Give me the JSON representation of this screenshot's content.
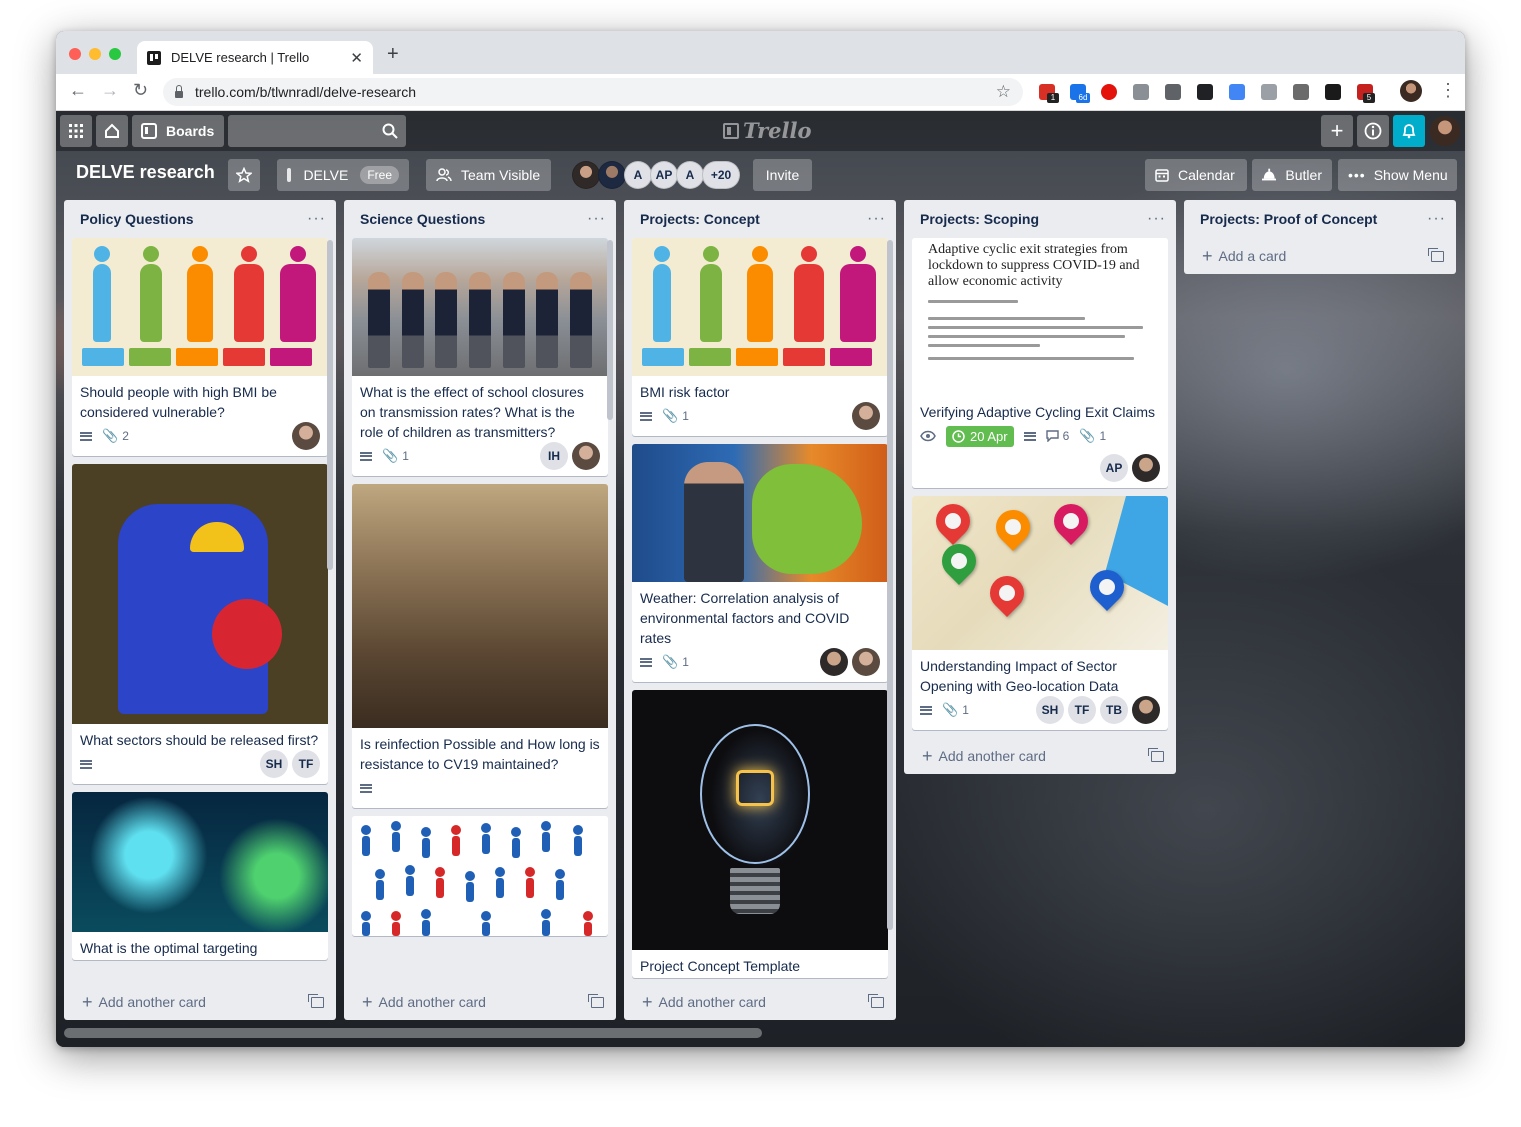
{
  "browser": {
    "tab_title": "DELVE research | Trello",
    "url": "trello.com/b/tlwnradl/delve-research",
    "ext_badges": [
      "1",
      "6d",
      "5"
    ]
  },
  "topbar": {
    "boards_label": "Boards",
    "logo_text": "Trello"
  },
  "board": {
    "title": "DELVE research",
    "team_name": "DELVE",
    "team_plan": "Free",
    "visibility": "Team Visible",
    "members": [
      "A",
      "AP",
      "A"
    ],
    "members_more": "+20",
    "invite": "Invite",
    "calendar": "Calendar",
    "butler": "Butler",
    "show_menu": "Show Menu"
  },
  "lists": [
    {
      "title": "Policy Questions",
      "add_label": "Add another card",
      "cards": [
        {
          "title": "Should people with high BMI be considered vulnerable?",
          "attachments": "2",
          "members": [
            "photo"
          ]
        },
        {
          "title": "What sectors should be released first?",
          "members": [
            "SH",
            "TF"
          ]
        },
        {
          "title": "What is the optimal targeting"
        }
      ]
    },
    {
      "title": "Science Questions",
      "add_label": "Add another card",
      "cards": [
        {
          "title": "What is the effect of school closures on transmission rates? What is the role of children as transmitters?",
          "attachments": "1",
          "members": [
            "IH",
            "photo"
          ]
        },
        {
          "title": "Is reinfection Possible and How long is resistance to CV19 maintained?"
        },
        {
          "title": ""
        }
      ]
    },
    {
      "title": "Projects: Concept",
      "add_label": "Add another card",
      "cards": [
        {
          "title": "BMI risk factor",
          "attachments": "1",
          "members": [
            "photo"
          ]
        },
        {
          "title": "Weather: Correlation analysis of environmental factors and COVID rates",
          "attachments": "1",
          "members": [
            "photo",
            "photo"
          ]
        },
        {
          "title": "Project Concept Template"
        }
      ]
    },
    {
      "title": "Projects: Scoping",
      "add_label": "Add another card",
      "cards": [
        {
          "title": "Verifying Adaptive Cycling Exit Claims",
          "cover_text": "Adaptive cyclic exit strategies from lockdown to suppress COVID-19 and allow economic activity",
          "due": "20 Apr",
          "comments": "6",
          "attachments": "1",
          "members": [
            "AP",
            "photo"
          ]
        },
        {
          "title": "Understanding Impact of Sector Opening with Geo-location Data",
          "attachments": "1",
          "members": [
            "SH",
            "TF",
            "TB",
            "photo"
          ]
        }
      ]
    },
    {
      "title": "Projects: Proof of Concept",
      "add_label": "Add a card",
      "cards": []
    }
  ],
  "colors": {
    "list_bg": "#ebecf0",
    "due_green": "#61bd4f",
    "notification_blue": "#00aecc"
  },
  "icons": [
    "apps-icon",
    "home-icon",
    "board-icon",
    "search-icon",
    "plus-icon",
    "info-icon",
    "bell-icon",
    "star-icon",
    "calendar-icon",
    "butler-icon",
    "ellipsis-icon",
    "description-icon",
    "attachment-icon",
    "eye-icon",
    "clock-icon",
    "comment-icon",
    "template-icon"
  ]
}
